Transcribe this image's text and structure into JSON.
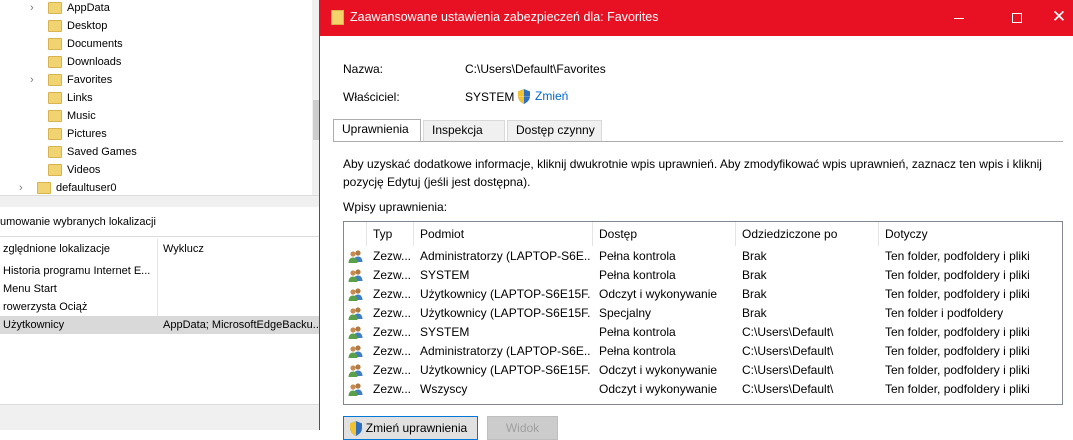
{
  "background": {
    "tree_items": [
      {
        "label": "AppData",
        "expandable": true
      },
      {
        "label": "Desktop",
        "expandable": false
      },
      {
        "label": "Documents",
        "expandable": false
      },
      {
        "label": "Downloads",
        "expandable": false
      },
      {
        "label": "Favorites",
        "expandable": true
      },
      {
        "label": "Links",
        "expandable": false
      },
      {
        "label": "Music",
        "expandable": false
      },
      {
        "label": "Pictures",
        "expandable": false
      },
      {
        "label": "Saved Games",
        "expandable": false
      },
      {
        "label": "Videos",
        "expandable": false
      }
    ],
    "tree_last": "defaultuser0",
    "section_title": "umowanie wybranych lokalizacji",
    "col_headers": [
      "zględnione lokalizacje",
      "Wyklucz"
    ],
    "rows": [
      {
        "c1": "Historia programu Internet E...",
        "c2": ""
      },
      {
        "c1": "Menu Start",
        "c2": ""
      },
      {
        "c1": "rowerzysta Ociąż",
        "c2": ""
      },
      {
        "c1": "Użytkownicy",
        "c2": "AppData; MicrosoftEdgeBacku..."
      }
    ]
  },
  "dialog": {
    "title": "Zaawansowane ustawienia zabezpieczeń dla: Favorites",
    "name_label": "Nazwa:",
    "name_value": "C:\\Users\\Default\\Favorites",
    "owner_label": "Właściciel:",
    "owner_value": "SYSTEM",
    "change_owner": "Zmień",
    "tabs": [
      "Uprawnienia",
      "Inspekcja",
      "Dostęp czynny"
    ],
    "info": "Aby uzyskać dodatkowe informacje, kliknij dwukrotnie wpis uprawnień. Aby zmodyfikować wpis uprawnień, zaznacz ten wpis i kliknij pozycję Edytuj (jeśli jest dostępna).",
    "entries_label": "Wpisy uprawnienia:",
    "columns": [
      "Typ",
      "Podmiot",
      "Dostęp",
      "Odziedziczone po",
      "Dotyczy"
    ],
    "entries": [
      {
        "type": "Zezw...",
        "principal": "Administratorzy (LAPTOP-S6E...",
        "access": "Pełna kontrola",
        "inherited": "Brak",
        "applies": "Ten folder, podfoldery i pliki"
      },
      {
        "type": "Zezw...",
        "principal": "SYSTEM",
        "access": "Pełna kontrola",
        "inherited": "Brak",
        "applies": "Ten folder, podfoldery i pliki"
      },
      {
        "type": "Zezw...",
        "principal": "Użytkownicy (LAPTOP-S6E15F...",
        "access": "Odczyt i wykonywanie",
        "inherited": "Brak",
        "applies": "Ten folder, podfoldery i pliki"
      },
      {
        "type": "Zezw...",
        "principal": "Użytkownicy (LAPTOP-S6E15F...",
        "access": "Specjalny",
        "inherited": "Brak",
        "applies": "Ten folder i podfoldery"
      },
      {
        "type": "Zezw...",
        "principal": "SYSTEM",
        "access": "Pełna kontrola",
        "inherited": "C:\\Users\\Default\\",
        "applies": "Ten folder, podfoldery i pliki"
      },
      {
        "type": "Zezw...",
        "principal": "Administratorzy (LAPTOP-S6E...",
        "access": "Pełna kontrola",
        "inherited": "C:\\Users\\Default\\",
        "applies": "Ten folder, podfoldery i pliki"
      },
      {
        "type": "Zezw...",
        "principal": "Użytkownicy (LAPTOP-S6E15F...",
        "access": "Odczyt i wykonywanie",
        "inherited": "C:\\Users\\Default\\",
        "applies": "Ten folder, podfoldery i pliki"
      },
      {
        "type": "Zezw...",
        "principal": "Wszyscy",
        "access": "Odczyt i wykonywanie",
        "inherited": "C:\\Users\\Default\\",
        "applies": "Ten folder, podfoldery i pliki"
      }
    ],
    "btn_change_perms": "Zmień uprawnienia",
    "btn_view": "Widok",
    "colors": {
      "titlebar": "#e81123",
      "link": "#0066cc",
      "accent": "#0078d7"
    }
  }
}
